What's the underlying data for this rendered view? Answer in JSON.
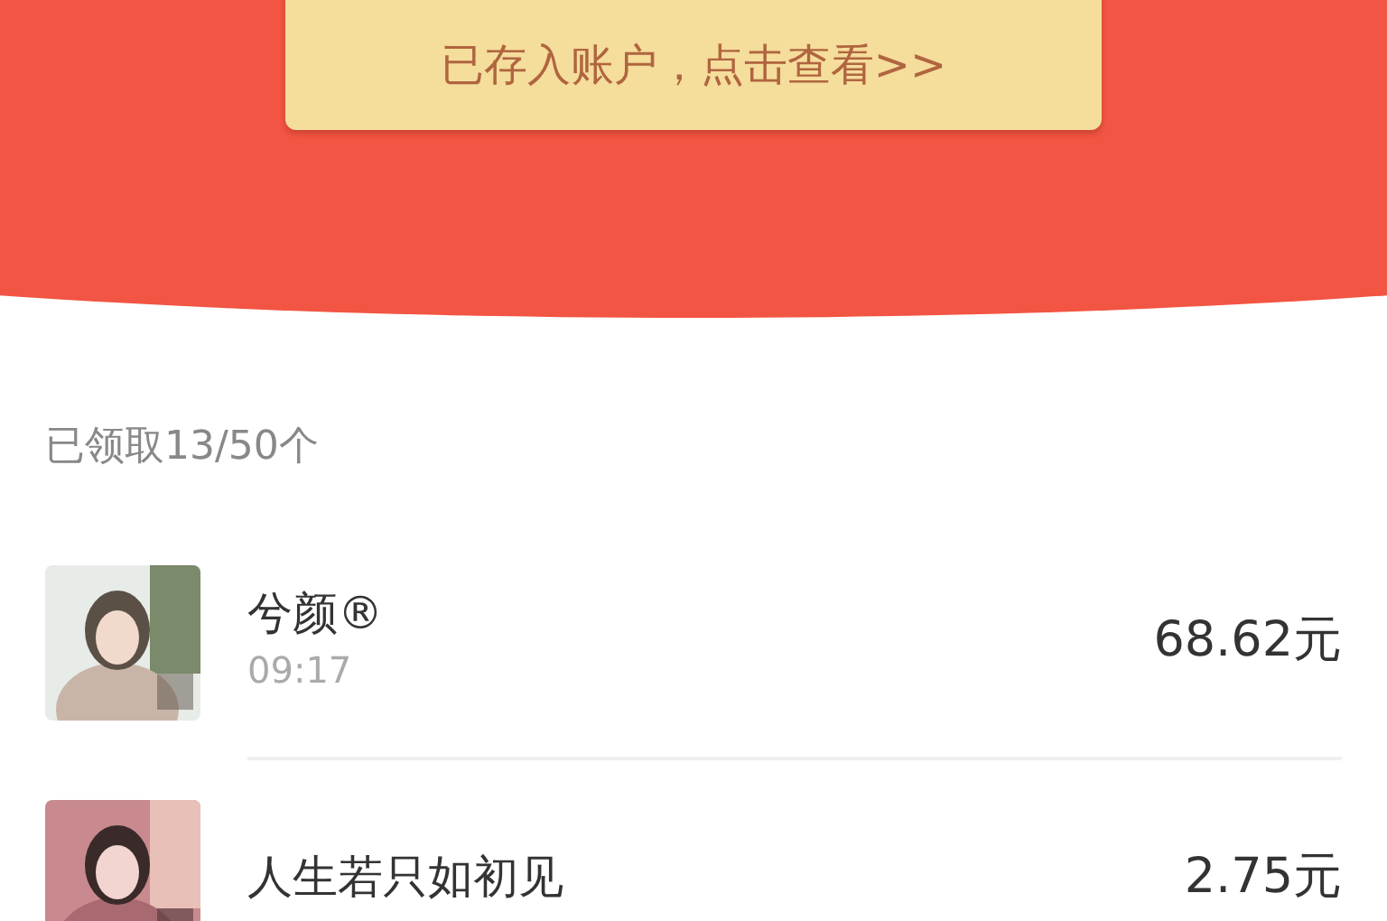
{
  "banner": {
    "button": "已存入账户，点击查看>>"
  },
  "summary": "已领取13/50个",
  "records": [
    {
      "name": "兮颜®",
      "time": "09:17",
      "amount": "68.62元"
    },
    {
      "name": "人生若只如初见",
      "amount": "2.75元"
    }
  ]
}
